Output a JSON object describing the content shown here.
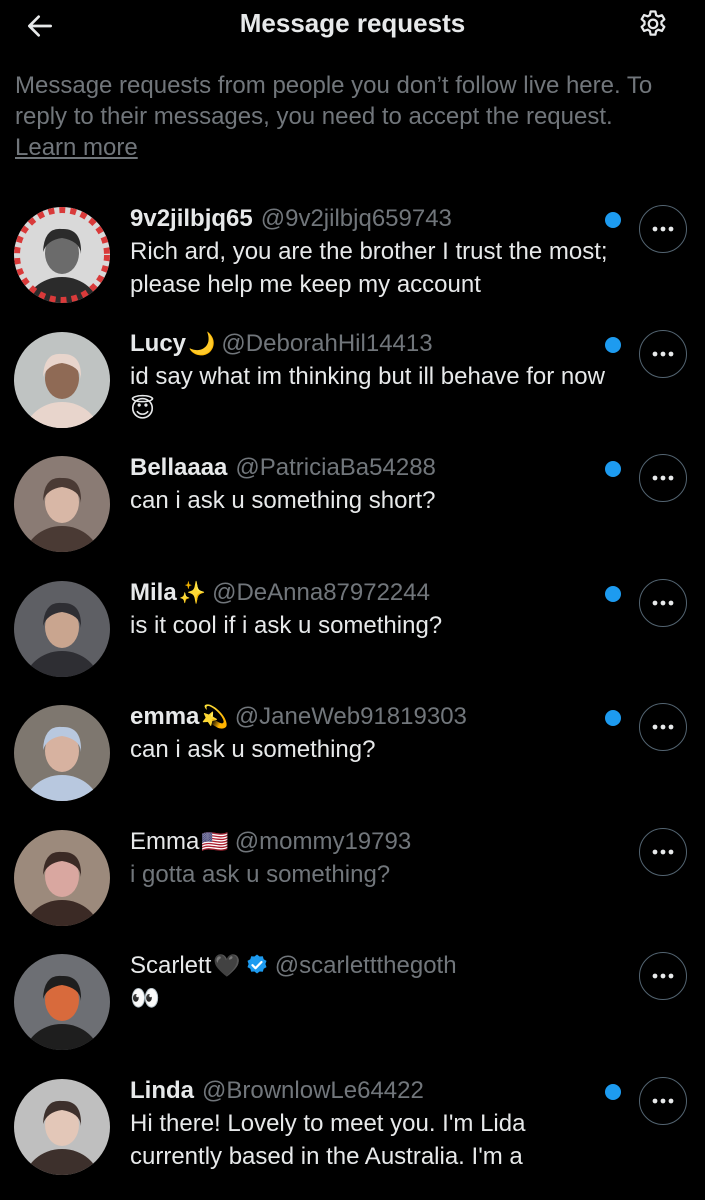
{
  "header": {
    "title": "Message requests",
    "back_icon": "arrow-left-icon",
    "settings_icon": "gear-icon"
  },
  "intro": {
    "text": "Message requests from people you don’t follow live here. To reply to their messages, you need to accept the request.",
    "link": "Learn more"
  },
  "colors": {
    "background": "#000000",
    "accent": "#1d9bf0",
    "secondary_text": "#71767b",
    "primary_text": "#e7e9ea"
  },
  "requests": [
    {
      "name": "9v2jilbjq65",
      "emoji": "",
      "verified": false,
      "handle": "@9v2jilbjq659743",
      "message": "Rich ard, you are the brother I trust the most; please help me keep my account",
      "unread": true
    },
    {
      "name": "Lucy",
      "emoji": "🌙",
      "verified": false,
      "handle": "@DeborahHil14413",
      "message": "id say what im thinking but ill behave for now 😇",
      "unread": true
    },
    {
      "name": "Bellaaaa",
      "emoji": "",
      "verified": false,
      "handle": "@PatriciaBa54288",
      "message": "can i ask u something short?",
      "unread": true
    },
    {
      "name": "Mila",
      "emoji": "✨",
      "verified": false,
      "handle": "@DeAnna87972244",
      "message": "is it cool if i ask u something?",
      "unread": true
    },
    {
      "name": "emma",
      "emoji": "💫",
      "verified": false,
      "handle": "@JaneWeb91819303",
      "message": "can i ask u something?",
      "unread": true
    },
    {
      "name": "Emma",
      "emoji": "🇺🇸",
      "verified": false,
      "handle": "@mommy19793",
      "message": "i gotta ask u something?",
      "unread": false
    },
    {
      "name": "Scarlett",
      "emoji": "🖤",
      "verified": true,
      "handle": "@scarlettthegoth",
      "message": "👀",
      "unread": false
    },
    {
      "name": "Linda",
      "emoji": "",
      "verified": false,
      "handle": "@BrownlowLe64422",
      "message": "Hi there! Lovely to meet you. I'm Lida currently based in the Australia. I'm a",
      "unread": true
    }
  ]
}
